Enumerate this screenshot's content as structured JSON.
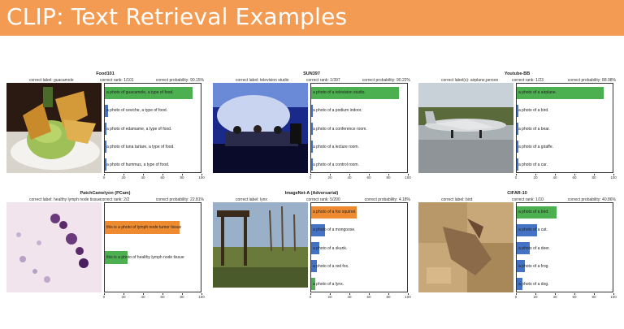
{
  "header": {
    "title": "CLIP: Text Retrieval Examples",
    "color": "#f39b52"
  },
  "axis_ticks": [
    "0",
    "20",
    "40",
    "60",
    "80",
    "100"
  ],
  "colors": {
    "correct": "#4caf50",
    "predicted_wrong": "#ee8a30",
    "other": "#4472c4"
  },
  "panels": [
    {
      "title": "Food101",
      "label_text": "correct label: guacamole",
      "rank_text": "correct rank: 1/101",
      "prob_text": "correct probability: 90.15%",
      "image": "guacamole-photo",
      "bars": [
        {
          "label": "a photo of guacamole, a type of food.",
          "value": 90,
          "kind": "correct"
        },
        {
          "label": "a photo of ceviche, a type of food.",
          "value": 3,
          "kind": "other"
        },
        {
          "label": "a photo of edamame, a type of food.",
          "value": 1.5,
          "kind": "other"
        },
        {
          "label": "a photo of tuna tartare, a type of food.",
          "value": 1,
          "kind": "other"
        },
        {
          "label": "a photo of hummus, a type of food.",
          "value": 1,
          "kind": "other"
        }
      ]
    },
    {
      "title": "SUN397",
      "label_text": "correct label: television studio",
      "rank_text": "correct rank: 1/397",
      "prob_text": "correct probability: 90.22%",
      "image": "television-studio-photo",
      "bars": [
        {
          "label": "a photo of a television studio.",
          "value": 90,
          "kind": "correct"
        },
        {
          "label": "a photo of a podium indoor.",
          "value": 2,
          "kind": "other"
        },
        {
          "label": "a photo of a conference room.",
          "value": 1.5,
          "kind": "other"
        },
        {
          "label": "a photo of a lecture room.",
          "value": 1,
          "kind": "other"
        },
        {
          "label": "a photo of a control room.",
          "value": 1,
          "kind": "other"
        }
      ]
    },
    {
      "title": "Youtube-BB",
      "label_text": "correct label(s): airplane,person",
      "rank_text": "correct rank: 1/23",
      "prob_text": "correct probability: 88.98%",
      "image": "airplane-photo",
      "bars": [
        {
          "label": "a photo of a airplane.",
          "value": 89,
          "kind": "correct"
        },
        {
          "label": "a photo of a bird.",
          "value": 2,
          "kind": "other"
        },
        {
          "label": "a photo of a bear.",
          "value": 1,
          "kind": "other"
        },
        {
          "label": "a photo of a giraffe.",
          "value": 1,
          "kind": "other"
        },
        {
          "label": "a photo of a car.",
          "value": 1,
          "kind": "other"
        }
      ]
    },
    {
      "title": "PatchCamelyon (PCam)",
      "label_text": "correct label: healthy lymph node tissue",
      "rank_text": "correct rank: 2/2",
      "prob_text": "correct probability: 22.81%",
      "image": "lymph-tissue-photo",
      "bars": [
        {
          "label": "this is a photo of lymph node tumor tissue",
          "value": 77,
          "kind": "predicted_wrong"
        },
        {
          "label": "this is a photo of healthy lymph node tissue",
          "value": 23,
          "kind": "correct"
        }
      ]
    },
    {
      "title": "ImageNet-A (Adversarial)",
      "label_text": "correct label: lynx",
      "rank_text": "correct rank: 5/200",
      "prob_text": "correct probability: 4.18%",
      "image": "lynx-adversarial-photo",
      "bars": [
        {
          "label": "a photo of a fox squirrel.",
          "value": 47,
          "kind": "predicted_wrong"
        },
        {
          "label": "a photo of a mongoose.",
          "value": 14,
          "kind": "other"
        },
        {
          "label": "a photo of a skunk.",
          "value": 8,
          "kind": "other"
        },
        {
          "label": "a photo of a red fox.",
          "value": 6,
          "kind": "other"
        },
        {
          "label": "a photo of a lynx.",
          "value": 4.18,
          "kind": "correct"
        }
      ]
    },
    {
      "title": "CIFAR-10",
      "label_text": "correct label: bird",
      "rank_text": "correct rank: 1/10",
      "prob_text": "correct probability: 40.86%",
      "image": "bird-cifar-photo",
      "bars": [
        {
          "label": "a photo of a bird.",
          "value": 41,
          "kind": "correct"
        },
        {
          "label": "a photo of a cat.",
          "value": 21,
          "kind": "other"
        },
        {
          "label": "a photo of a deer.",
          "value": 13,
          "kind": "other"
        },
        {
          "label": "a photo of a frog.",
          "value": 8,
          "kind": "other"
        },
        {
          "label": "a photo of a dog.",
          "value": 6,
          "kind": "other"
        }
      ]
    }
  ]
}
